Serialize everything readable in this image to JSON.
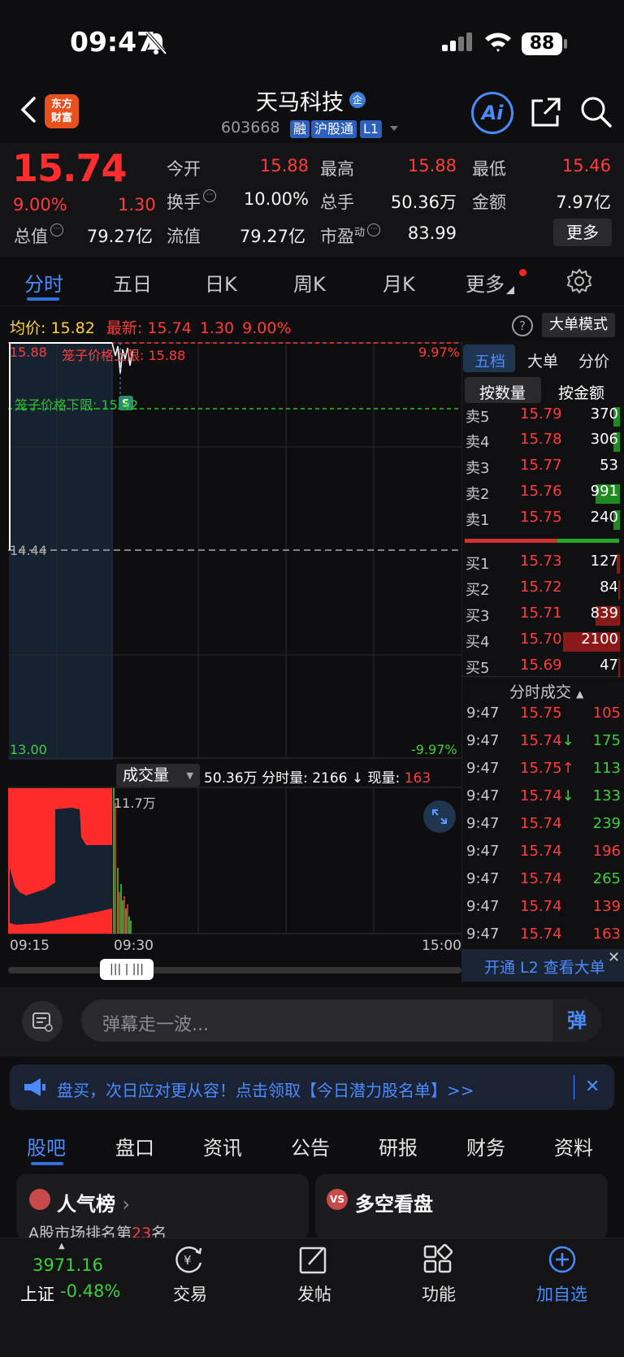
{
  "status_bar": {
    "time": "09:47",
    "battery": "88"
  },
  "header": {
    "logo_line1": "东方",
    "logo_line2": "财富",
    "stock_name": "天马科技",
    "badge": "企",
    "stock_code": "603668",
    "tags": [
      "融",
      "沪股通",
      "L1"
    ],
    "ai_label": "Ai"
  },
  "quote": {
    "price": "15.74",
    "change_pct": "9.00%",
    "change": "1.30",
    "today_open_label": "今开",
    "today_open": "15.88",
    "high_label": "最高",
    "high": "15.88",
    "low_label": "最低",
    "low": "15.46",
    "turnover_label": "换手",
    "turnover": "10.00%",
    "volume_label": "总手",
    "volume": "50.36万",
    "amount_label": "金额",
    "amount": "7.97亿",
    "mktcap_label": "总值",
    "mktcap": "79.27亿",
    "float_label": "流值",
    "float_cap": "79.27亿",
    "pe_label": "市盈",
    "pe_sup": "动",
    "pe": "83.99",
    "more_label": "更多"
  },
  "tabs": [
    "分时",
    "五日",
    "日K",
    "周K",
    "月K",
    "更多"
  ],
  "info_row": {
    "avg_label": "均价:",
    "avg": "15.82",
    "latest_label": "最新:",
    "latest": "15.74",
    "latest_chg": "1.30",
    "latest_pct": "9.00%",
    "big_mode": "大单模式"
  },
  "chart_labels": {
    "top_price": "15.88",
    "top_pct": "9.97%",
    "cage_upper": "笼子价格上限: 15.88",
    "cage_lower": "笼子价格下限: 15.42",
    "mid_price": "14.44",
    "bottom_price": "13.00",
    "bottom_pct": "-9.97%",
    "vol_max": "11.7万",
    "time_start": "09:15",
    "time_open": "09:30",
    "time_end": "15:00"
  },
  "volume_row": {
    "selector": "成交量",
    "total": "50.36万",
    "period_label": "分时量:",
    "period": "2166",
    "current_label": "现量:",
    "current": "163"
  },
  "right_panel": {
    "tabs": [
      "五档",
      "大单",
      "分价"
    ],
    "subtabs": [
      "按数量",
      "按金额"
    ],
    "sell": [
      {
        "label": "卖5",
        "price": "15.79",
        "vol": "370"
      },
      {
        "label": "卖4",
        "price": "15.78",
        "vol": "306"
      },
      {
        "label": "卖3",
        "price": "15.77",
        "vol": "53"
      },
      {
        "label": "卖2",
        "price": "15.76",
        "vol": "991"
      },
      {
        "label": "卖1",
        "price": "15.75",
        "vol": "240"
      }
    ],
    "buy": [
      {
        "label": "买1",
        "price": "15.73",
        "vol": "127"
      },
      {
        "label": "买2",
        "price": "15.72",
        "vol": "84"
      },
      {
        "label": "买3",
        "price": "15.71",
        "vol": "839"
      },
      {
        "label": "买4",
        "price": "15.70",
        "vol": "2100"
      },
      {
        "label": "买5",
        "price": "15.69",
        "vol": "47"
      }
    ],
    "ticks_title": "分时成交",
    "ticks": [
      {
        "time": "9:47",
        "price": "15.75",
        "arrow": "",
        "vol": "105",
        "dir": "red"
      },
      {
        "time": "9:47",
        "price": "15.74",
        "arrow": "↓",
        "vol": "175",
        "dir": "green"
      },
      {
        "time": "9:47",
        "price": "15.75",
        "arrow": "↑",
        "vol": "113",
        "dir": "green"
      },
      {
        "time": "9:47",
        "price": "15.74",
        "arrow": "↓",
        "vol": "133",
        "dir": "green"
      },
      {
        "time": "9:47",
        "price": "15.74",
        "arrow": "",
        "vol": "239",
        "dir": "green"
      },
      {
        "time": "9:47",
        "price": "15.74",
        "arrow": "",
        "vol": "196",
        "dir": "red"
      },
      {
        "time": "9:47",
        "price": "15.74",
        "arrow": "",
        "vol": "265",
        "dir": "green"
      },
      {
        "time": "9:47",
        "price": "15.74",
        "arrow": "",
        "vol": "139",
        "dir": "red"
      },
      {
        "time": "9:47",
        "price": "15.74",
        "arrow": "",
        "vol": "163",
        "dir": "red"
      }
    ],
    "l2_banner": "开通 L2 查看大单"
  },
  "danmu": {
    "placeholder": "弹幕走一波...",
    "send": "弹"
  },
  "ad": {
    "text": "盘买，次日应对更从容！点击领取【今日潜力股名单】>>"
  },
  "bottom_tabs": [
    "股吧",
    "盘口",
    "资讯",
    "公告",
    "研报",
    "财务",
    "资料"
  ],
  "cards": {
    "card1_title": "人气榜",
    "card1_sub_pre": "A股市场排名第",
    "card1_rank": "23",
    "card1_sub_post": "名",
    "card2_title": "多空看盘"
  },
  "bottom_nav": {
    "index_value": "3971.16",
    "index_name": "上证",
    "index_pct": "-0.48%",
    "items": [
      "交易",
      "发帖",
      "功能",
      "加自选"
    ]
  },
  "colors": {
    "up": "#ff3b3b",
    "down": "#3bd13b",
    "accent": "#4a8bff"
  }
}
